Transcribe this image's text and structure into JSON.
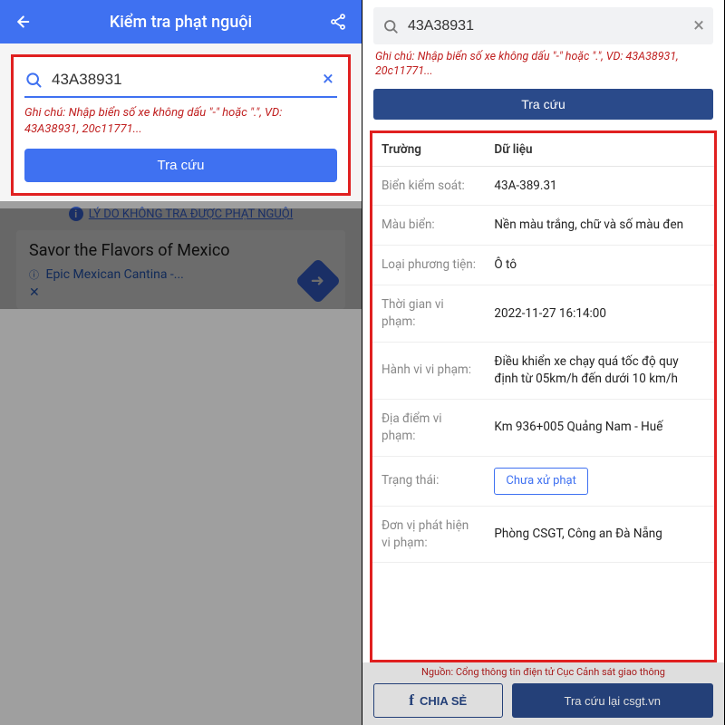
{
  "left": {
    "header": {
      "title": "Kiểm tra phạt nguội"
    },
    "search": {
      "value": "43A38931",
      "hint": "Ghi chú: Nhập biển số xe không dấu \"-\" hoặc \".\", VD: 43A38931, 20c11771...",
      "submit_label": "Tra cứu"
    },
    "reason_link": "LÝ DO KHÔNG TRA ĐƯỢC PHẠT NGUỘI",
    "ad": {
      "title": "Savor the Flavors of Mexico",
      "subtitle": "Epic Mexican Cantina -..."
    }
  },
  "right": {
    "search": {
      "value": "43A38931",
      "hint": "Ghi chú: Nhập biển số xe không dấu \"-\" hoặc \".\", VD: 43A38931, 20c11771...",
      "submit_label": "Tra cứu"
    },
    "table": {
      "headers": {
        "field": "Trường",
        "data": "Dữ liệu"
      },
      "rows": [
        {
          "field": "Biển kiểm soát:",
          "data": "43A-389.31"
        },
        {
          "field": "Màu biển:",
          "data": "Nền màu trắng, chữ và số màu đen"
        },
        {
          "field": "Loại phương tiện:",
          "data": "Ô tô"
        },
        {
          "field": "Thời gian vi phạm:",
          "data": "2022-11-27 16:14:00"
        },
        {
          "field": "Hành vi vi phạm:",
          "data": "Điều khiển xe chạy quá tốc độ quy định từ 05km/h đến dưới 10 km/h"
        },
        {
          "field": "Địa điểm vi phạm:",
          "data": "Km 936+005 Quảng Nam - Huế"
        },
        {
          "field": "Trạng thái:",
          "data": "Chưa xử phạt",
          "chip": true
        },
        {
          "field": "Đơn vị phát hiện vi phạm:",
          "data": "Phòng CSGT, Công an  Đà Nẵng"
        }
      ]
    },
    "source_text": "Nguồn: Cổng thông tin điện tử Cục Cảnh sát giao thông",
    "share_label": "CHIA SẺ",
    "retry_label": "Tra cứu lại csgt.vn"
  }
}
